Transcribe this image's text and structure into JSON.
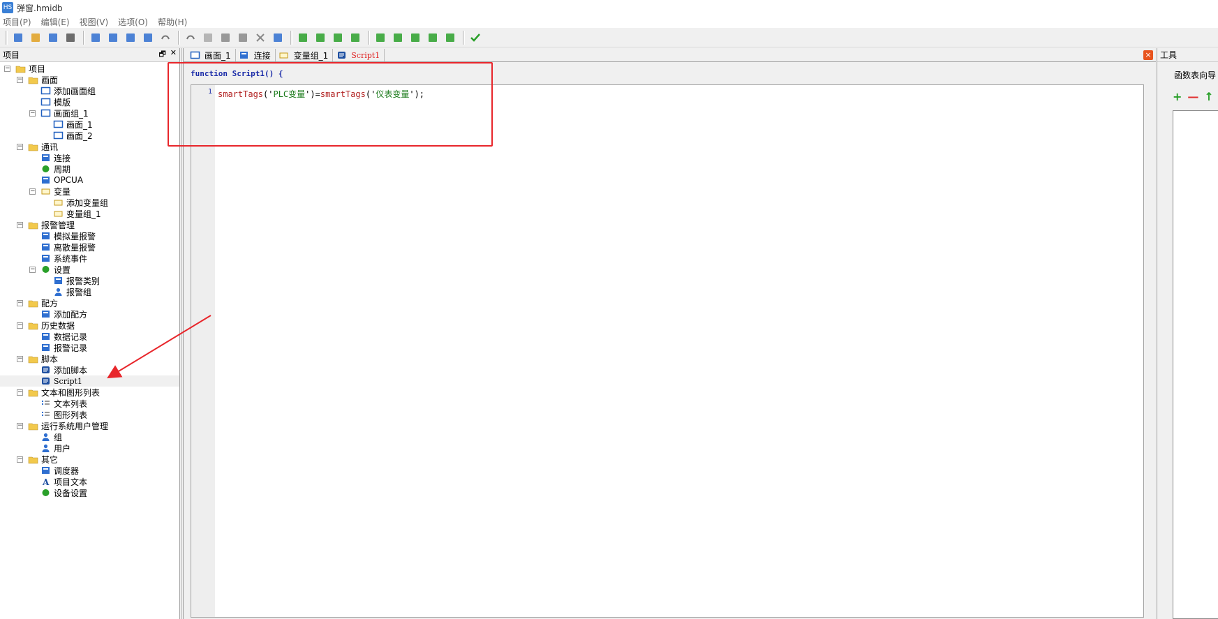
{
  "window": {
    "title": "弹窗.hmidb",
    "app_icon": "app-logo-icon"
  },
  "menu": [
    "项目(P)",
    "编辑(E)",
    "视图(V)",
    "选项(O)",
    "帮助(H)"
  ],
  "toolbar_icons": [
    "new-icon",
    "open-icon",
    "save-icon",
    "print-icon",
    "screen-list-icon",
    "screen-new-icon",
    "download-icon",
    "upload-icon",
    "undo-icon",
    "redo-icon",
    "cut-icon",
    "copy-icon",
    "paste-icon",
    "delete-icon",
    "find-icon",
    "compile-c-icon",
    "compile-f-icon",
    "compile-sv-icon",
    "compile-sf-icon",
    "insert-row-icon",
    "insert-col-icon",
    "edit-icon",
    "remove-icon",
    "download-device-icon",
    "check-icon"
  ],
  "project_panel": {
    "title": "项目",
    "tree": [
      {
        "label": "项目",
        "level": 0,
        "expander": "−",
        "icon": "project-icon"
      },
      {
        "label": "画面",
        "level": 1,
        "expander": "−",
        "icon": "screen-folder-icon"
      },
      {
        "label": "添加画面组",
        "level": 2,
        "expander": "",
        "icon": "add-screen-group-icon"
      },
      {
        "label": "模版",
        "level": 2,
        "expander": "",
        "icon": "template-icon"
      },
      {
        "label": "画面组_1",
        "level": 2,
        "expander": "−",
        "icon": "screen-group-icon"
      },
      {
        "label": "画面_1",
        "level": 3,
        "expander": "",
        "icon": "screen-icon"
      },
      {
        "label": "画面_2",
        "level": 3,
        "expander": "",
        "icon": "screen-icon"
      },
      {
        "label": "通讯",
        "level": 1,
        "expander": "−",
        "icon": "comm-folder-icon"
      },
      {
        "label": "连接",
        "level": 2,
        "expander": "",
        "icon": "connection-icon"
      },
      {
        "label": "周期",
        "level": 2,
        "expander": "",
        "icon": "cycle-icon"
      },
      {
        "label": "OPCUA",
        "level": 2,
        "expander": "",
        "icon": "opcua-icon"
      },
      {
        "label": "变量",
        "level": 2,
        "expander": "−",
        "icon": "tags-icon"
      },
      {
        "label": "添加变量组",
        "level": 3,
        "expander": "",
        "icon": "add-tag-group-icon"
      },
      {
        "label": "变量组_1",
        "level": 3,
        "expander": "",
        "icon": "tag-group-icon"
      },
      {
        "label": "报警管理",
        "level": 1,
        "expander": "−",
        "icon": "alarm-folder-icon"
      },
      {
        "label": "模拟量报警",
        "level": 2,
        "expander": "",
        "icon": "analog-alarm-icon"
      },
      {
        "label": "离散量报警",
        "level": 2,
        "expander": "",
        "icon": "discrete-alarm-icon"
      },
      {
        "label": "系统事件",
        "level": 2,
        "expander": "",
        "icon": "system-event-icon"
      },
      {
        "label": "设置",
        "level": 2,
        "expander": "−",
        "icon": "settings-icon"
      },
      {
        "label": "报警类别",
        "level": 3,
        "expander": "",
        "icon": "alarm-class-icon"
      },
      {
        "label": "报警组",
        "level": 3,
        "expander": "",
        "icon": "alarm-group-icon"
      },
      {
        "label": "配方",
        "level": 1,
        "expander": "−",
        "icon": "recipe-folder-icon"
      },
      {
        "label": "添加配方",
        "level": 2,
        "expander": "",
        "icon": "add-recipe-icon"
      },
      {
        "label": "历史数据",
        "level": 1,
        "expander": "−",
        "icon": "history-folder-icon"
      },
      {
        "label": "数据记录",
        "level": 2,
        "expander": "",
        "icon": "data-log-icon"
      },
      {
        "label": "报警记录",
        "level": 2,
        "expander": "",
        "icon": "alarm-log-icon"
      },
      {
        "label": "脚本",
        "level": 1,
        "expander": "−",
        "icon": "script-folder-icon"
      },
      {
        "label": "添加脚本",
        "level": 2,
        "expander": "",
        "icon": "add-script-icon"
      },
      {
        "label": "Script1",
        "level": 2,
        "expander": "",
        "icon": "script-icon",
        "selected": true,
        "mono": true
      },
      {
        "label": "文本和图形列表",
        "level": 1,
        "expander": "−",
        "icon": "list-folder-icon"
      },
      {
        "label": "文本列表",
        "level": 2,
        "expander": "",
        "icon": "text-list-icon"
      },
      {
        "label": "图形列表",
        "level": 2,
        "expander": "",
        "icon": "graphic-list-icon"
      },
      {
        "label": "运行系统用户管理",
        "level": 1,
        "expander": "−",
        "icon": "user-mgmt-folder-icon"
      },
      {
        "label": "组",
        "level": 2,
        "expander": "",
        "icon": "group-icon"
      },
      {
        "label": "用户",
        "level": 2,
        "expander": "",
        "icon": "user-icon"
      },
      {
        "label": "其它",
        "level": 1,
        "expander": "−",
        "icon": "other-folder-icon"
      },
      {
        "label": "调度器",
        "level": 2,
        "expander": "",
        "icon": "scheduler-icon"
      },
      {
        "label": "项目文本",
        "level": 2,
        "expander": "",
        "icon": "project-text-icon"
      },
      {
        "label": "设备设置",
        "level": 2,
        "expander": "",
        "icon": "device-settings-icon"
      }
    ]
  },
  "editor": {
    "tabs": [
      {
        "label": "画面_1",
        "icon": "screen-icon"
      },
      {
        "label": "连接",
        "icon": "connection-icon"
      },
      {
        "label": "变量组_1",
        "icon": "tag-group-icon"
      },
      {
        "label": "Script1",
        "icon": "script-icon",
        "active": true
      }
    ],
    "function_header": "function Script1() {",
    "line_number": "1",
    "code": {
      "fn1": "smartTags",
      "p1": "('",
      "s1": "PLC变量",
      "p2": "')=",
      "fn2": "smartTags",
      "p3": "('",
      "s2": "仪表变量",
      "p4": "');"
    },
    "colors": {
      "keyword": "#1a2ba8",
      "function": "#b22222",
      "string": "#1a7a1a",
      "highlight": "#e8262b"
    }
  },
  "tools_panel": {
    "title": "工具",
    "wizard_title": "函数表向导",
    "buttons": [
      {
        "glyph": "+",
        "icon": "add-icon",
        "color": "#2aa02a"
      },
      {
        "glyph": "—",
        "icon": "remove-icon",
        "color": "#e03030"
      },
      {
        "glyph": "↑",
        "icon": "move-up-icon",
        "color": "#2aa02a"
      }
    ]
  }
}
